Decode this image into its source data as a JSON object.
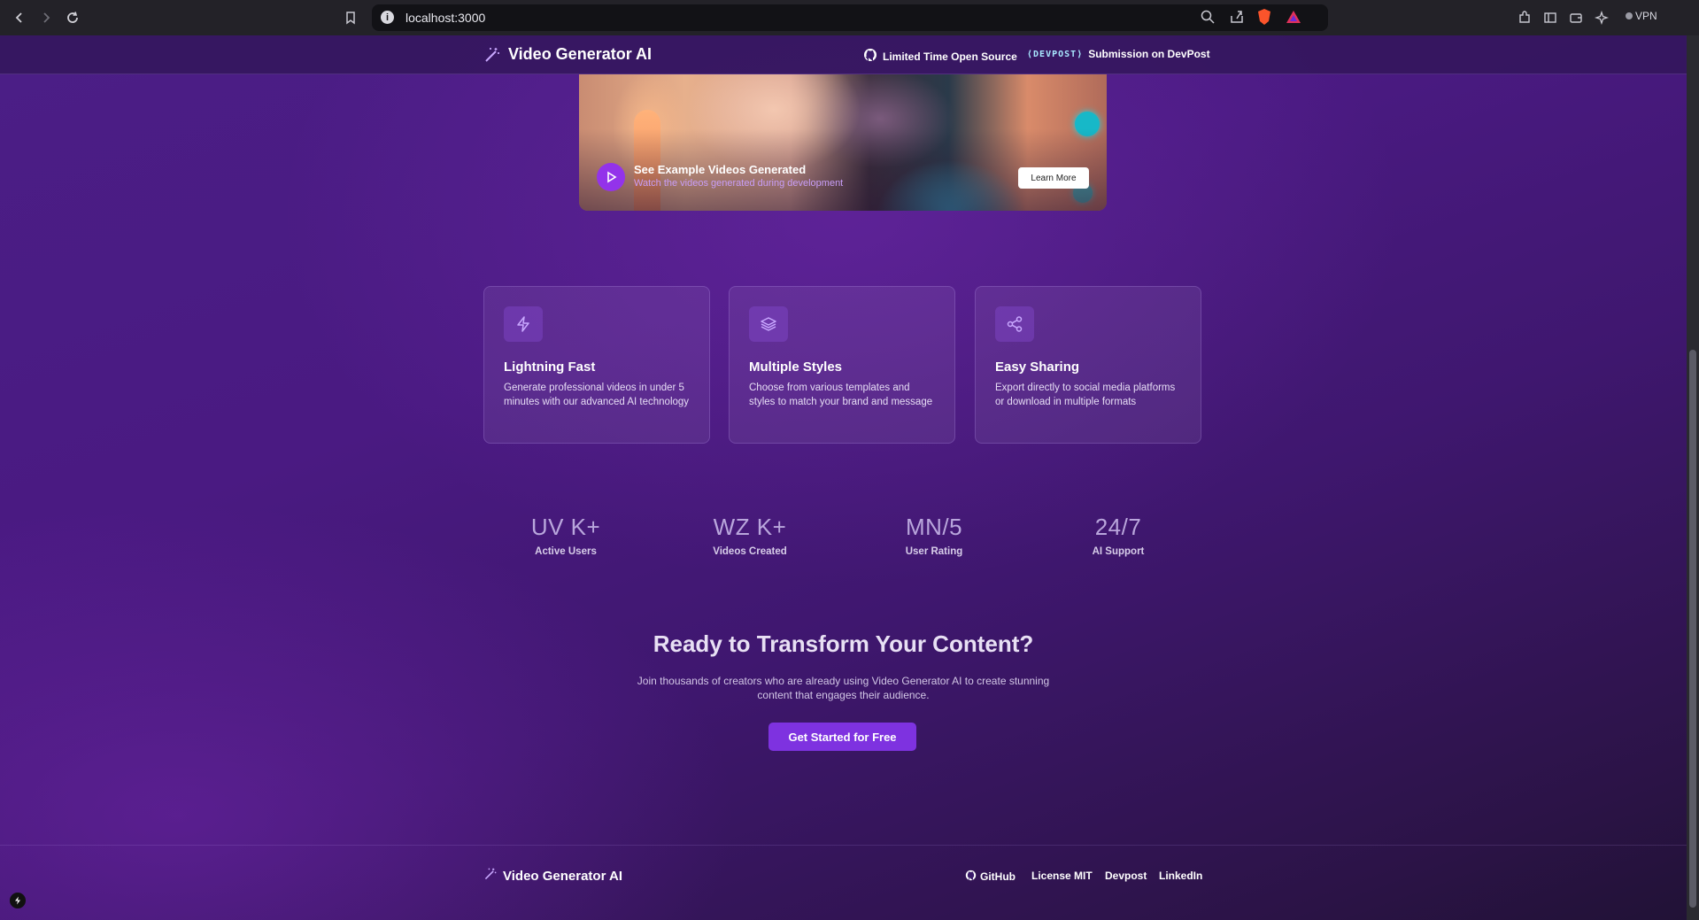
{
  "browser": {
    "url": "localhost:3000",
    "vpn_label": "VPN"
  },
  "header": {
    "brand": "Video Generator AI",
    "github_link": "Limited Time Open Source",
    "devpost_logo": "DEVPOST",
    "devpost_link": "Submission on DevPost"
  },
  "hero": {
    "title": "See Example Videos Generated",
    "subtitle": "Watch the videos generated during development",
    "learn_more": "Learn More"
  },
  "features": [
    {
      "title": "Lightning Fast",
      "description": "Generate professional videos in under 5 minutes with our advanced AI technology",
      "icon": "zap-icon"
    },
    {
      "title": "Multiple Styles",
      "description": "Choose from various templates and styles to match your brand and message",
      "icon": "layers-icon"
    },
    {
      "title": "Easy Sharing",
      "description": "Export directly to social media platforms or download in multiple formats",
      "icon": "share-icon"
    }
  ],
  "stats": [
    {
      "value": "UV K+",
      "label": "Active Users"
    },
    {
      "value": "WZ K+",
      "label": "Videos Created"
    },
    {
      "value": "MN/5",
      "label": "User Rating"
    },
    {
      "value": "24/7",
      "label": "AI Support"
    }
  ],
  "cta": {
    "title": "Ready to Transform Your Content?",
    "text": "Join thousands of creators who are already using Video Generator AI to create stunning content that engages their audience.",
    "button": "Get Started for Free"
  },
  "footer": {
    "brand": "Video Generator AI",
    "links": [
      "GitHub",
      "License MIT",
      "Devpost",
      "LinkedIn"
    ]
  },
  "colors": {
    "accent": "#7e32e0",
    "background": "#4a1a82"
  }
}
